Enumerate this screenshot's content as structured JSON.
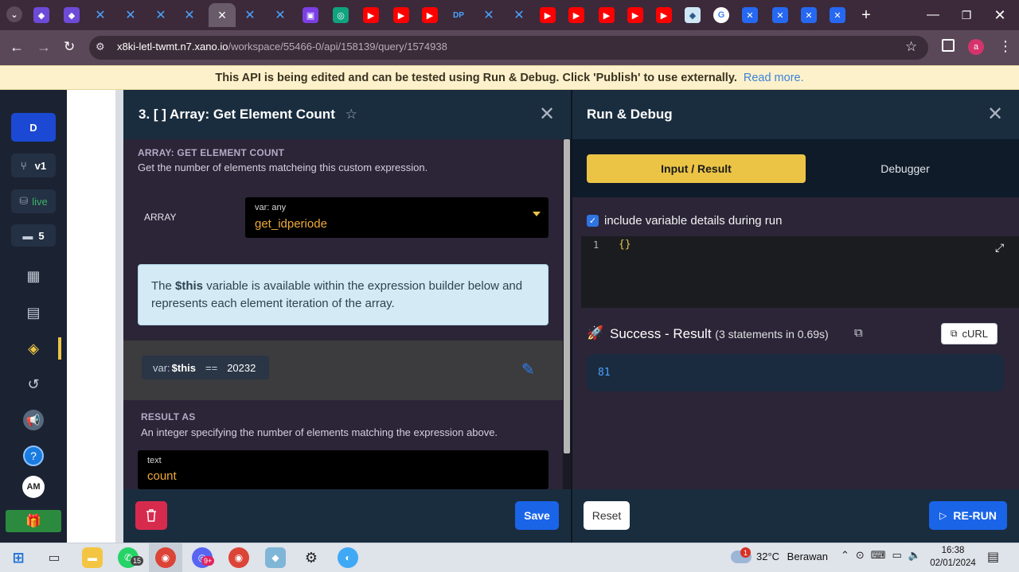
{
  "browser": {
    "url_host": "x8ki-letl-twmt.n7.xano.io",
    "url_path": "/workspace/55466-0/api/158139/query/1574938",
    "profile_initial": "a",
    "tab_close": "×",
    "new_tab": "+"
  },
  "banner": {
    "message": "This API is being edited and can be tested using Run & Debug. Click 'Publish' to use externally.",
    "link": "Read more."
  },
  "sidebar": {
    "workspace_initial": "D",
    "version": "v1",
    "status": "live",
    "comments_count": "5",
    "user_initials": "AM",
    "help": "?"
  },
  "step": {
    "title": "3. [ ] Array: Get Element Count",
    "section_label": "ARRAY: GET ELEMENT COUNT",
    "section_desc": "Get the number of elements matcheing this custom expression.",
    "array_label": "ARRAY",
    "array_var_type": "var: any",
    "array_value": "get_idperiode",
    "info_prefix": "The ",
    "info_bold": "$this",
    "info_suffix": " variable is available within the expression builder below and represents each element iteration of the array.",
    "expr_var_prefix": "var:",
    "expr_var": "$this",
    "expr_op": "==",
    "expr_value": "20232",
    "result_label": "RESULT AS",
    "result_desc": "An integer specifying the number of elements matching the expression above.",
    "result_type": "text",
    "result_value": "count",
    "save_label": "Save"
  },
  "debug": {
    "title": "Run & Debug",
    "tab_input": "Input / Result",
    "tab_debugger": "Debugger",
    "include_details": "include variable details during run",
    "editor_line": "1",
    "editor_content": "{}",
    "success_label": "Success - Result",
    "success_meta": "(3 statements in 0.69s)",
    "curl_label": "cURL",
    "result_value": "81",
    "reset_label": "Reset",
    "rerun_label": "RE-RUN"
  },
  "taskbar": {
    "whatsapp_badge": "15",
    "discord_badge": "9+",
    "weather_badge": "1",
    "temperature": "32°C",
    "weather": "Berawan",
    "time": "16:38",
    "date": "02/01/2024"
  },
  "colors": {
    "accent_blue": "#1a64e8",
    "accent_yellow": "#ebc446",
    "danger": "#d72b4e",
    "live_green": "#3bb36a",
    "value_orange": "#f0a93a"
  }
}
